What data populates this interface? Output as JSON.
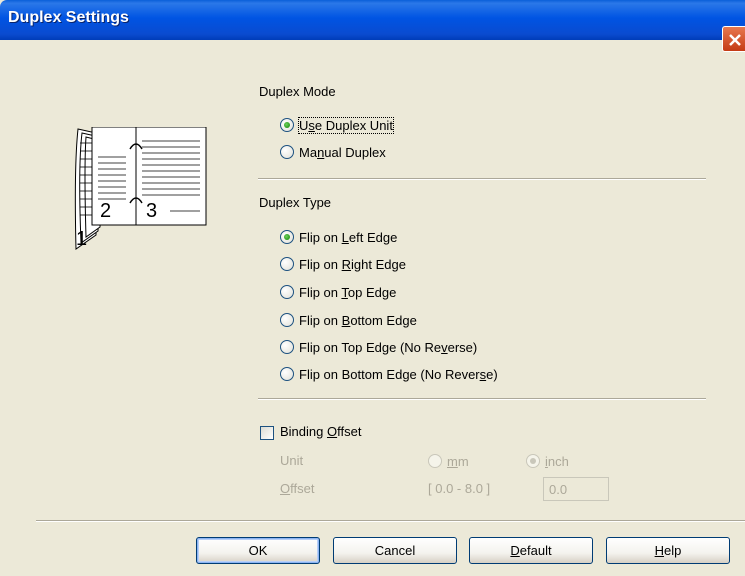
{
  "window": {
    "title": "Duplex Settings"
  },
  "duplex_mode": {
    "label": "Duplex Mode",
    "options": [
      {
        "pre": "U",
        "key": "s",
        "post": "e Duplex Unit",
        "checked": true
      },
      {
        "pre": "Ma",
        "key": "n",
        "post": "ual Duplex",
        "checked": false
      }
    ]
  },
  "illustration": {
    "page_numbers": [
      "1",
      "2",
      "3"
    ]
  },
  "duplex_type": {
    "label": "Duplex Type",
    "options": [
      {
        "pre": "Flip on ",
        "key": "L",
        "post": "eft Edge",
        "checked": true
      },
      {
        "pre": "Flip on ",
        "key": "R",
        "post": "ight Edge",
        "checked": false
      },
      {
        "pre": "Flip on ",
        "key": "T",
        "post": "op Edge",
        "checked": false
      },
      {
        "pre": "Flip on ",
        "key": "B",
        "post": "ottom Edge",
        "checked": false
      },
      {
        "pre": "Flip on Top Edge (No Re",
        "key": "v",
        "post": "erse)",
        "checked": false
      },
      {
        "pre": "Flip on Bottom Edge (No Rever",
        "key": "s",
        "post": "e)",
        "checked": false
      }
    ]
  },
  "binding_offset": {
    "checkbox": {
      "pre": "Binding ",
      "key": "O",
      "post": "ffset",
      "checked": false
    },
    "unit_label": "Unit",
    "unit_options": [
      {
        "key": "m",
        "post": "m",
        "checked": false
      },
      {
        "key": "i",
        "post": "nch",
        "checked": true
      }
    ],
    "offset_label_key": "O",
    "offset_label_post": "ffset",
    "range": "[ 0.0 - 8.0 ]",
    "value": "0.0"
  },
  "buttons": {
    "ok": "OK",
    "cancel": "Cancel",
    "default": {
      "key": "D",
      "post": "efault"
    },
    "help": {
      "key": "H",
      "post": "elp"
    }
  },
  "colors": {
    "titlebar": "#0054e3",
    "dialog_bg": "#ece9d8",
    "radio_checked": "#2a9b1c",
    "disabled_text": "#aca899"
  }
}
